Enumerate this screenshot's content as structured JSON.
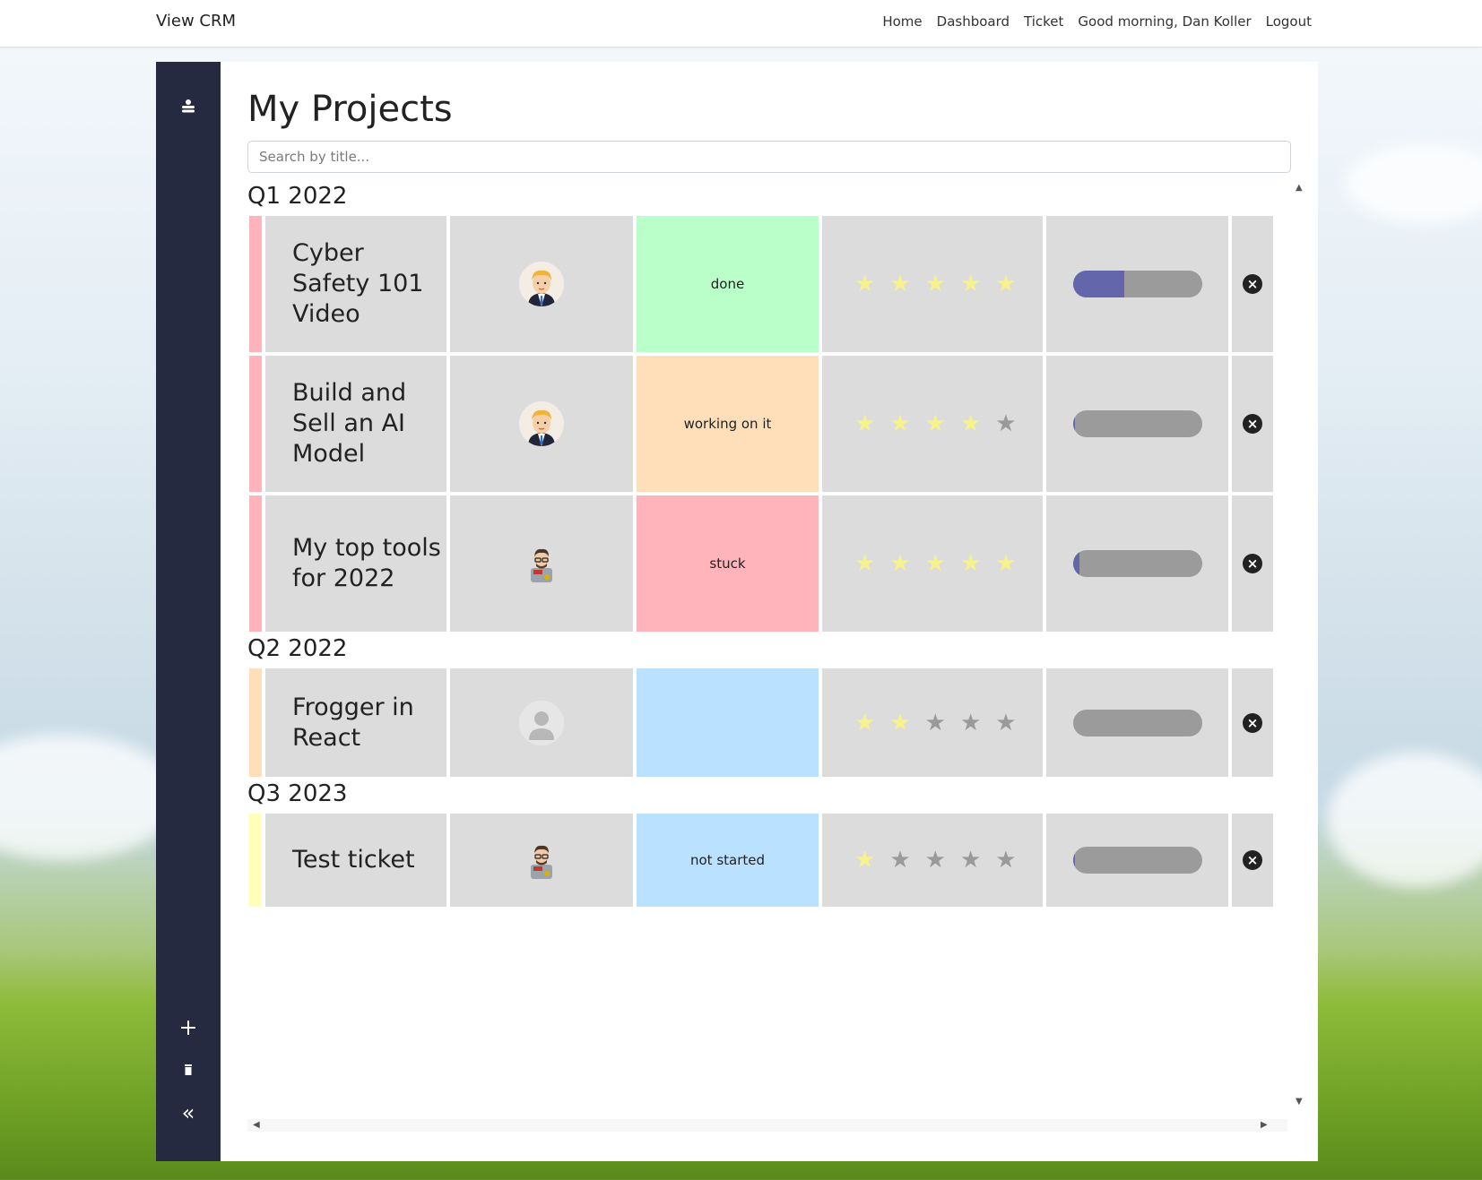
{
  "navbar": {
    "brand": "View CRM",
    "links": [
      "Home",
      "Dashboard",
      "Ticket",
      "Good morning, Dan Koller",
      "Logout"
    ]
  },
  "sidebar": {
    "top_icon": "person-stack-icon",
    "bottom_icons": [
      "plus-icon",
      "trash-icon",
      "double-chevron-left-icon"
    ]
  },
  "page": {
    "title": "My Projects",
    "search_placeholder": "Search by title..."
  },
  "groups": [
    {
      "title": "Q1 2022",
      "accent": "#ffb3ba",
      "rows": [
        {
          "title": "Cyber Safety 101 Video",
          "owner": "blond-man-avatar",
          "status": "done",
          "status_color": "#baffc9",
          "rating": 5,
          "progress": 0.4
        },
        {
          "title": "Build and Sell an AI Model",
          "owner": "blond-man-avatar",
          "status": "working on it",
          "status_color": "#ffdfba",
          "rating": 4,
          "progress": 0.02
        },
        {
          "title": "My top tools for 2022",
          "owner": "glasses-man-avatar",
          "status": "stuck",
          "status_color": "#ffb3ba",
          "rating": 5,
          "progress": 0.05
        }
      ]
    },
    {
      "title": "Q2 2022",
      "accent": "#ffdfba",
      "rows": [
        {
          "title": "Frogger in React",
          "owner": "default-user-avatar",
          "status": "",
          "status_color": "#bae1ff",
          "rating": 2,
          "progress": 0
        }
      ]
    },
    {
      "title": "Q3 2023",
      "accent": "#ffffba",
      "rows": [
        {
          "title": "Test ticket",
          "owner": "glasses-man-avatar",
          "status": "not started",
          "status_color": "#bae1ff",
          "rating": 1,
          "progress": 0.02
        }
      ]
    }
  ],
  "colors": {
    "sidebar": "#262a40",
    "progress_fill": "#6466ac",
    "progress_track": "#9b9b9b",
    "star_on": "#f7f28c",
    "star_off": "#9a9a9a",
    "cell_bg": "#dcdcdc"
  }
}
